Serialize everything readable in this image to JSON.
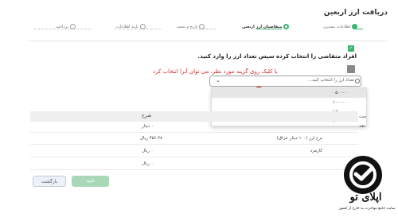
{
  "page_title": "دریافت ارز اربعین",
  "steps": [
    {
      "label": "اطلاعات مشتری",
      "state": "done"
    },
    {
      "label": "متقاضیان ارز اربعین",
      "state": "active"
    },
    {
      "label": "تاریخ و شعبه",
      "state": "pending"
    },
    {
      "label": "تایید اطلاعات",
      "state": "pending"
    },
    {
      "label": "پرداخت",
      "state": "pending"
    }
  ],
  "instruction": "افراد متقاضی را انتخاب کرده سپس تعداد ارز را وارد کنید.",
  "annotation": "با کلیک روی گزینه مورد نظر، می توان آنرا انتخاب کرد",
  "select": {
    "placeholder": "تعداد ارز را انتخاب کنید..."
  },
  "dropdown_options": [
    "۵۰۰۰۰",
    "۱۰۰۰۰۰",
    "۱۵۰۰۰۰",
    "۲۰۰۰۰۰"
  ],
  "table": {
    "header_label": "شرح",
    "side_header": "مت",
    "side_row1": "تعد",
    "rows": [
      {
        "label": "",
        "value": "۰ دینار"
      },
      {
        "label": "نرخ ارز (۱۰۰ دینار عراق)",
        "value": "۳۵۶.۴۸ ریال"
      },
      {
        "label": "کارمزد",
        "value": "۰ ریال"
      },
      {
        "label": "",
        "value": "۰ ریال"
      }
    ]
  },
  "buttons": {
    "back": "بازگشت",
    "confirm": "تایید"
  },
  "logo": {
    "name": "اپلای تو",
    "tagline": "سایت جامع مهاجرت به خارج از کشور"
  },
  "colors": {
    "accent": "#3cb371",
    "annotation": "#d42a2a"
  }
}
